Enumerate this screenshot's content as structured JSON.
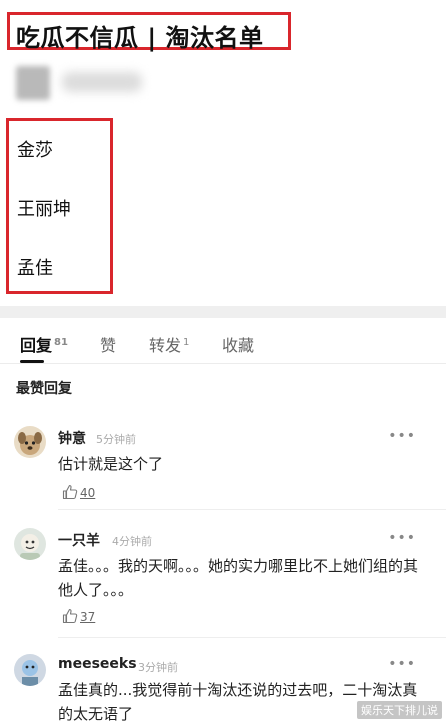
{
  "post": {
    "title": "吃瓜不信瓜 | 淘汰名单",
    "eliminated": [
      "金莎",
      "王丽坤",
      "孟佳"
    ]
  },
  "tabs": [
    {
      "label": "回复",
      "count": "81",
      "active": true
    },
    {
      "label": "赞",
      "count": "",
      "active": false
    },
    {
      "label": "转发",
      "count": "1",
      "active": false
    },
    {
      "label": "收藏",
      "count": "",
      "active": false
    }
  ],
  "section_title": "最赞回复",
  "comments": [
    {
      "name": "钟意",
      "time": "5分钟前",
      "text": "估计就是这个了",
      "likes": "40",
      "more": "•••"
    },
    {
      "name": "一只羊",
      "time": "4分钟前",
      "text": "孟佳。。。我的天啊。。。她的实力哪里比不上她们组的其他人了。。。",
      "likes": "37",
      "more": "•••"
    },
    {
      "name": "meeseeks",
      "time": "3分钟前",
      "text": "孟佳真的...我觉得前十淘汰还说的过去吧，二十淘汰真的太无语了",
      "likes": "",
      "more": "•••"
    }
  ],
  "watermark": "娱乐天下排儿说",
  "colors": {
    "highlight_red": "#d9262c",
    "tab_active": "#111111",
    "divider": "#efefef"
  }
}
